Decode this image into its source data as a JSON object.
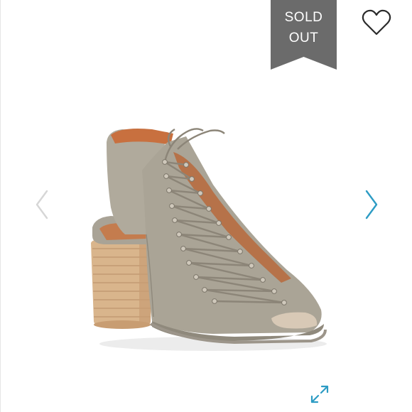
{
  "badge": {
    "line1": "SOLD",
    "line2": "OUT",
    "color": "#6b6b6b"
  },
  "icons": {
    "like": "heart-outline-icon",
    "prev": "chevron-left-icon",
    "next": "chevron-right-icon",
    "expand": "expand-diagonal-icon"
  },
  "colors": {
    "accent": "#2d9cc4",
    "disabled_arrow": "#d6d6d6",
    "badge": "#6b6b6b"
  }
}
